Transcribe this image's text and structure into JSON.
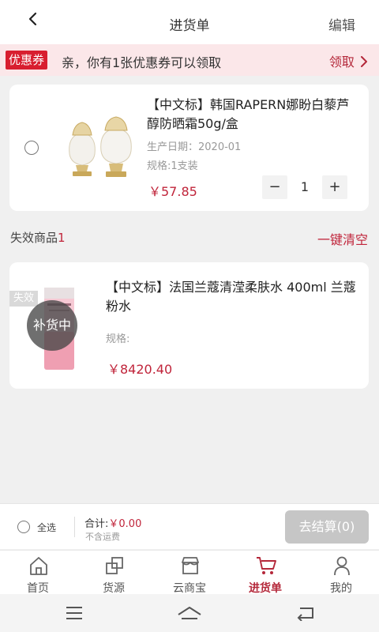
{
  "header": {
    "back_icon": "back-arrow-icon",
    "title": "进货单",
    "edit_label": "编辑"
  },
  "coupon": {
    "badge": "优惠券",
    "text": "亲，你有1张优惠券可以领取",
    "action": "领取",
    "action_icon": "chevron-right-icon"
  },
  "cart_item": {
    "name": "【中文标】韩国RAPERN娜盼白藜芦醇防晒霜50g/盒",
    "production_date": "生产日期：2020-01",
    "spec": "规格:1支装",
    "price": "￥57.85",
    "quantity": "1",
    "minus": "−",
    "plus": "+"
  },
  "invalid_section": {
    "label": "失效商品",
    "count": "1",
    "clear_label": "一键清空"
  },
  "invalid_item": {
    "expired_tag": "失效",
    "restock_label": "补货中",
    "name": "【中文标】法国兰蔻清滢柔肤水 400ml 兰蔻粉水",
    "spec": "规格:",
    "price": "￥8420.40"
  },
  "footer": {
    "select_all": "全选",
    "total_label": "合计:",
    "total_amount": "￥0.00",
    "shipping_note": "不含运费",
    "checkout_label": "去结算(0)"
  },
  "tabs": [
    {
      "label": "首页",
      "icon": "home-icon"
    },
    {
      "label": "货源",
      "icon": "source-icon"
    },
    {
      "label": "云商宝",
      "icon": "store-icon"
    },
    {
      "label": "进货单",
      "icon": "cart-icon",
      "active": true
    },
    {
      "label": "我的",
      "icon": "user-icon"
    }
  ],
  "colors": {
    "accent": "#c0243a",
    "coupon_bg": "#fbe7e9",
    "badge_bg": "#d81e2f",
    "checkout_disabled": "#c6c6c6"
  }
}
